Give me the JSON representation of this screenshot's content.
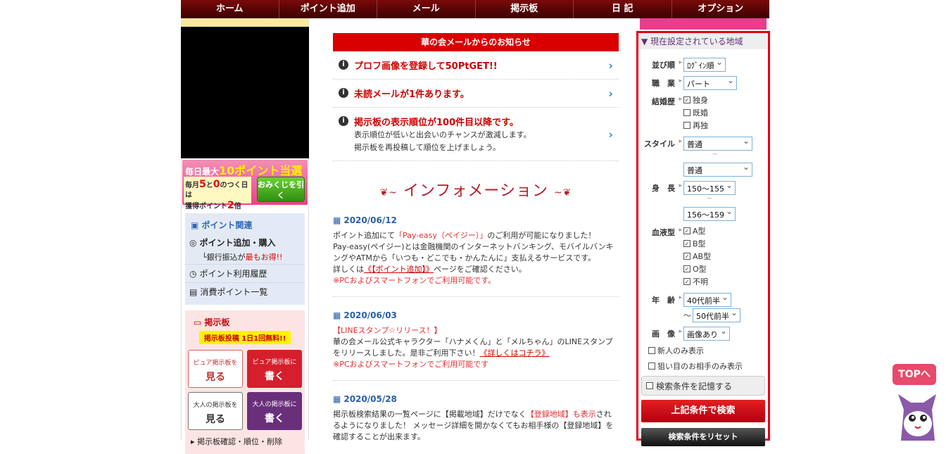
{
  "nav": [
    "ホーム",
    "ポイント追加",
    "メール",
    "掲示板",
    "日 記",
    "オプション"
  ],
  "banner": {
    "line1_a": "毎日最大",
    "line1_b": "10ポイント当選",
    "line2_a": "毎月",
    "line2_b": "5",
    "line2_c": "と",
    "line2_d": "0",
    "line2_e": "のつく日は",
    "line3_a": "獲得ポイント",
    "line3_b": "2",
    "line3_c": "倍",
    "omikuji": "おみくじを引く"
  },
  "point_panel": {
    "title": "ポイント関連",
    "buy": "ポイント追加・購入",
    "bank_a": "└銀行振込が",
    "bank_b": "最もお得!!",
    "history": "ポイント利用履歴",
    "consumption": "消費ポイント一覧"
  },
  "board_panel": {
    "title": "掲示板",
    "free": "掲示板投稿 1日1回無料!!",
    "pure_view_small": "ピュア掲示板を",
    "pure_view": "見る",
    "pure_write_small": "ピュア掲示板に",
    "pure_write": "書く",
    "adult_view_small": "大人の掲示板を",
    "adult_view": "見る",
    "adult_write_small": "大人の掲示板に",
    "adult_write": "書く",
    "more": "▸ 掲示板確認・順位・削除"
  },
  "notice": {
    "header": "華の会メールからのお知らせ",
    "items": [
      {
        "text": "プロフ画像を登録して50PtGET!!",
        "desc1": "",
        "desc2": ""
      },
      {
        "text": "未読メールが1件あります。",
        "desc1": "",
        "desc2": ""
      },
      {
        "text": "掲示板の表示順位が100件目以降です。",
        "desc1": "表示順位が低いと出会いのチャンスが激減します。",
        "desc2": "掲示板を再投稿して順位を上げましょう。"
      }
    ]
  },
  "info_title": "インフォメーション",
  "news": [
    {
      "date": "2020/06/12",
      "l1a": "ポイント追加にて",
      "l1b": "「Pay-easy（ペイジー）」",
      "l1c": "のご利用が可能になりました！",
      "l2": "Pay-easy(ペイジー)とは金融機関のインターネットバンキング、モバイルバンキングやATMから「いつも・どこでも・かんたんに」支払えるサービスです。",
      "l3a": "詳しくは",
      "l3b": "《【ポイント追加】》",
      "l3c": "ページをご確認ください。",
      "l4": "※PCおよびスマートフォンでご利用可能です。"
    },
    {
      "date": "2020/06/03",
      "l1": "【LINEスタンプ☆リリース！】",
      "l2": "華の会メール公式キャラクター「ハナメくん」と「メルちゃん」のLINEスタンプをリリースしました。是非ご利用下さい！",
      "l2link": "《詳しくはコチラ》",
      "l3": "※PCおよびスマートフォンでご利用可能です"
    },
    {
      "date": "2020/05/28",
      "l1a": "掲示板検索結果の一覧ページに【掲載地域】だけでなく",
      "l1b": "【登録地域】も表示",
      "l1c": "されるようになりました！ メッセージ詳細を開かなくてもお相手様の【登録地域】を確認することが出来ます。"
    }
  ],
  "search": {
    "header": "▼ 現在設定されている地域",
    "sort_label": "並び順",
    "sort_value": "ﾛｸﾞｲﾝ順",
    "job_label": "職　業",
    "job_value": "パート",
    "marital_label": "結婚歴",
    "marital": [
      "独身",
      "既婚",
      "再独"
    ],
    "style_label": "スタイル",
    "style_from": "普通",
    "style_to": "普通",
    "height_label": "身　長",
    "height_from": "150～155",
    "height_to": "156～159",
    "blood_label": "血液型",
    "blood": [
      "A型",
      "B型",
      "AB型",
      "O型",
      "不明"
    ],
    "age_label": "年　齢",
    "age_from": "40代前半",
    "age_tilde": "～",
    "age_to": "50代前半",
    "image_label": "画　像",
    "image_value": "画像あり",
    "new_only": "新人のみ表示",
    "target_only": "狙い目のお相手のみ表示",
    "remember": "検索条件を記憶する",
    "search_btn": "上記条件で検索",
    "reset_btn": "検索条件をリセット"
  },
  "top_button": "TOPへ"
}
